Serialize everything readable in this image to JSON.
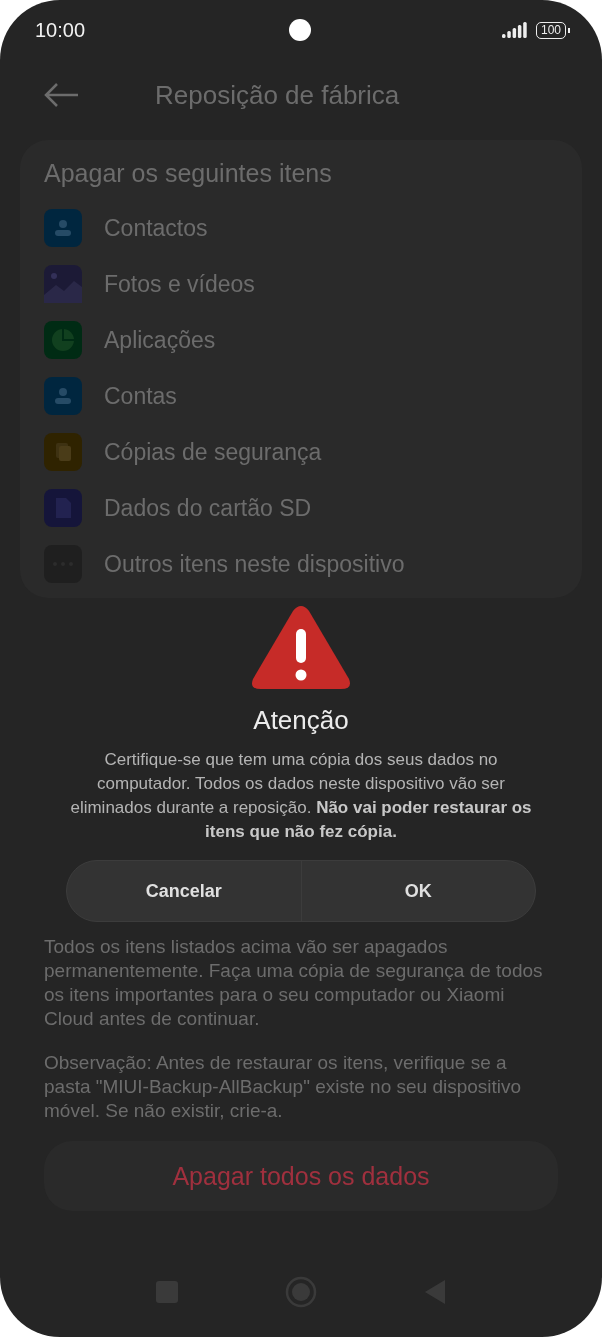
{
  "status_bar": {
    "time": "10:00",
    "battery": "100"
  },
  "header": {
    "title": "Reposição de fábrica"
  },
  "section": {
    "heading": "Apagar os seguintes itens",
    "items": [
      {
        "label": "Contactos",
        "kind": "contact"
      },
      {
        "label": "Fotos e vídeos",
        "kind": "gallery"
      },
      {
        "label": "Aplicações",
        "kind": "apps"
      },
      {
        "label": "Contas",
        "kind": "contact"
      },
      {
        "label": "Cópias de segurança",
        "kind": "backup"
      },
      {
        "label": "Dados do cartão SD",
        "kind": "sdcard"
      },
      {
        "label": "Outros itens neste dispositivo",
        "kind": "more"
      }
    ]
  },
  "notes": [
    "Todos os itens listados acima vão ser apagados permanentemente. Faça uma cópia de segurança de todos os itens importantes para o seu computador ou Xiaomi Cloud antes de continuar.",
    "Observação: Antes de restaurar os itens, verifique se a pasta \"MIUI-Backup-AllBackup\" existe no seu dispositivo móvel. Se não existir, crie-a."
  ],
  "erase_button": {
    "label": "Apagar todos os dados"
  },
  "dialog": {
    "title": "Atenção",
    "message": "Certifique-se que tem uma cópia dos seus dados no computador. Todos os dados neste dispositivo vão ser eliminados durante a reposição. **Não vai poder restaurar os itens que não fez cópia.**",
    "buttons": [
      "Cancelar",
      "OK"
    ]
  }
}
